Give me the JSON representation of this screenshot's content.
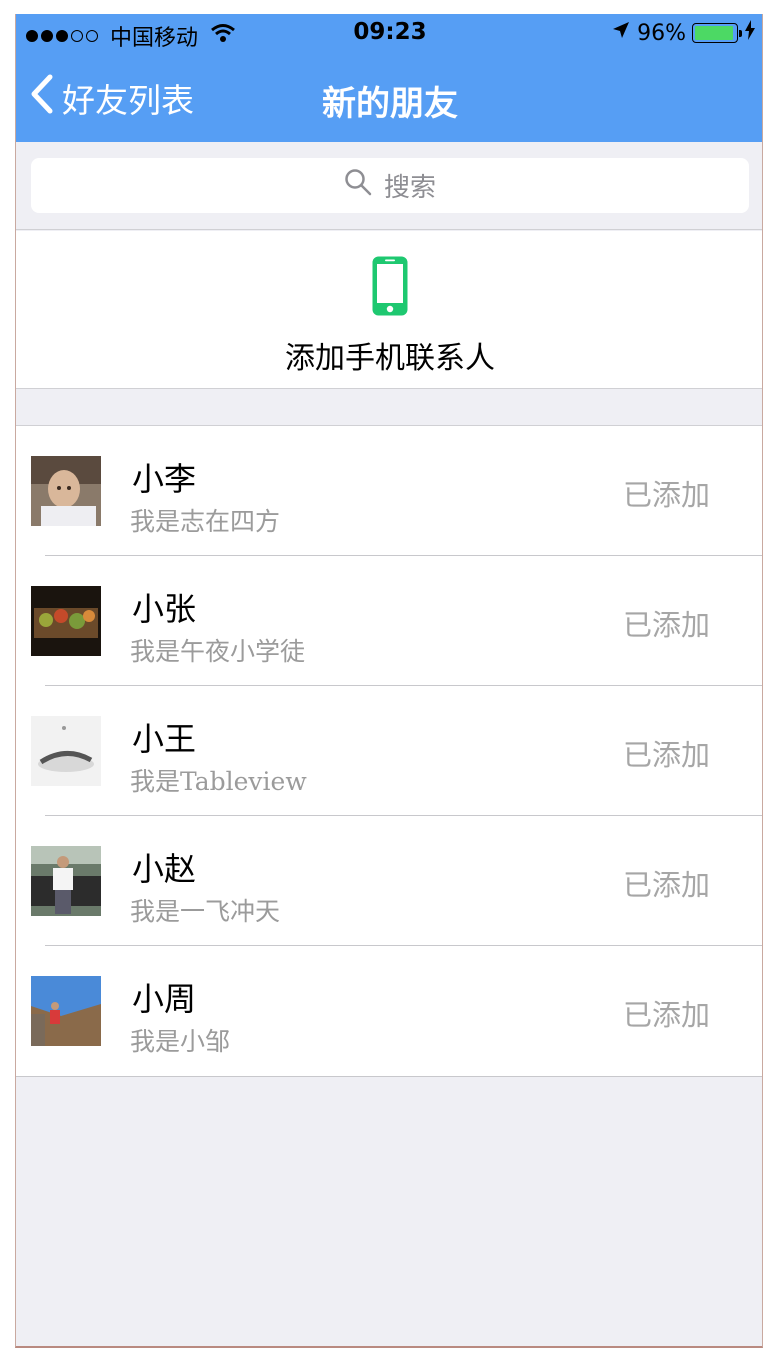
{
  "status_bar": {
    "carrier": "中国移动",
    "time": "09:23",
    "battery": "96%",
    "battery_level": 0.96
  },
  "nav": {
    "back_label": "好友列表",
    "title": "新的朋友"
  },
  "search": {
    "placeholder": "搜索"
  },
  "add_contacts": {
    "label": "添加手机联系人"
  },
  "friends": [
    {
      "name": "小李",
      "subtitle": "我是志在四方",
      "status": "已添加"
    },
    {
      "name": "小张",
      "subtitle": "我是午夜小学徒",
      "status": "已添加"
    },
    {
      "name": "小王",
      "subtitle": "我是Tableview",
      "status": "已添加"
    },
    {
      "name": "小赵",
      "subtitle": "我是一飞冲天",
      "status": "已添加"
    },
    {
      "name": "小周",
      "subtitle": "我是小邹",
      "status": "已添加"
    }
  ],
  "colors": {
    "nav_blue": "#569ef4",
    "accent_green": "#1ec870",
    "battery_green": "#4cd964"
  }
}
